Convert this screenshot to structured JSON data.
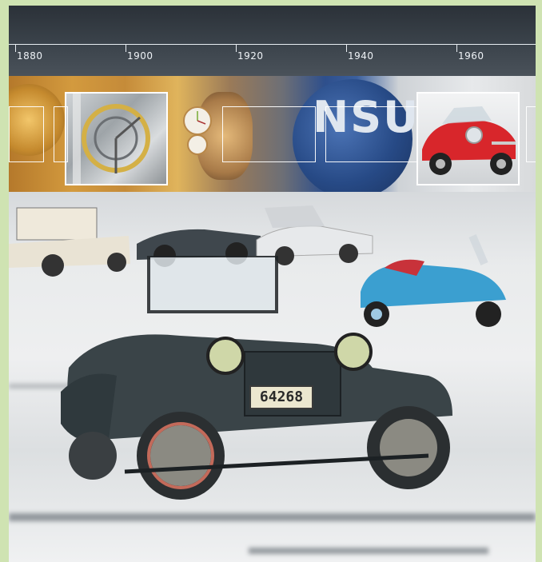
{
  "timeline": {
    "years": [
      "1880",
      "1900",
      "1920",
      "1940",
      "1960"
    ]
  },
  "strip": {
    "logo_text": "NSU"
  },
  "main_car": {
    "license_plate": "64268"
  },
  "colors": {
    "frame_green": "#cfe3b2",
    "timeline_dark": "#2b3138",
    "sidecar_blue": "#3b9fd0",
    "sports_car_red": "#d8262b"
  }
}
